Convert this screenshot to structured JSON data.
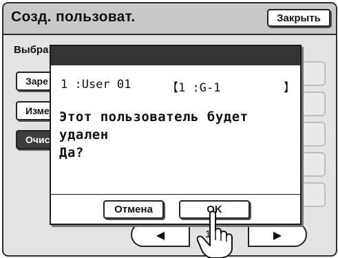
{
  "header": {
    "title": "Созд. пользоват.",
    "close_label": "Закрыть"
  },
  "main": {
    "select_label": "Выбра",
    "side_buttons": [
      {
        "label": "Заре"
      },
      {
        "label": "Изме"
      },
      {
        "label": "Очис"
      }
    ],
    "page_number": "1/2",
    "left_arrow": "◀",
    "right_arrow": "▶"
  },
  "dialog": {
    "user_number": "1 :User 01",
    "group_open": "【1 :G-1",
    "group_close": "】",
    "message_line1": "Этот пользователь будет",
    "message_line2": "удален",
    "message_line3": "Да?",
    "cancel_label": "Отмена",
    "ok_label": "OK"
  },
  "colors": {
    "dialog_bar": "#353535",
    "selected_button": "#3d3d3d",
    "panel_bg": "#e3e3e3"
  }
}
